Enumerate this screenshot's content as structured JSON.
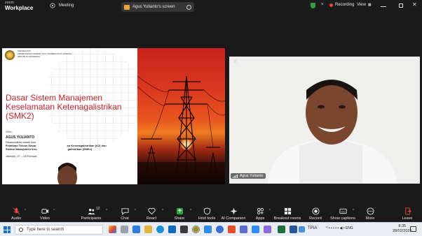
{
  "app": {
    "logo_line1": "zoom",
    "logo_line2": "Workplace",
    "meeting_label": "Meeting"
  },
  "share": {
    "label": "Agus Yulianto's screen"
  },
  "recording": {
    "label": "Recording"
  },
  "view": {
    "label": "View"
  },
  "slide": {
    "agency_lines": [
      "PERSENTASI",
      "KEMENTERIAN ENERGI DAN SUMBER DAYA MINERAL",
      "REPUBLIK INDONESIA"
    ],
    "title": "Dasar Sistem Manajemen Keselamatan Ketenagalistrikan (SMK2)",
    "by": "Oleh:",
    "presenter": "AGUS YULIANTO",
    "line1": "Disampaikan dalam Aca",
    "line2a": "Pelatihan Teknis Dasar",
    "line2b": "an Ketenagalistrikan (K2) dan",
    "line3a": "Sistem Manajemen Kes",
    "line3b": "galistrikan (SMK2)",
    "place": "Jakarta | 27 – 28 Februar"
  },
  "participant_tile": {
    "remove_pin": "Remove pin",
    "name": "Agus Yulianto"
  },
  "toolbar": {
    "audio": "Audio",
    "video": "Video",
    "participants": "Participants",
    "participants_count": "12",
    "chat": "Chat",
    "react": "React",
    "share": "Share",
    "host_tools": "Host tools",
    "ai_companion": "AI Companion",
    "apps": "Apps",
    "breakout_rooms": "Breakout rooms",
    "record": "Record",
    "show_captions": "Show captions",
    "more": "More",
    "leave": "Leave"
  },
  "taskbar": {
    "search_placeholder": "Type here to search",
    "tray_label": "TPIA",
    "time": "8:35",
    "date": "28/02/2025"
  },
  "colors": {
    "accent_green": "#2ea043",
    "record_red": "#e8483f",
    "slide_title_red": "#c3242a",
    "share_icon_orange": "#f0a23a"
  }
}
